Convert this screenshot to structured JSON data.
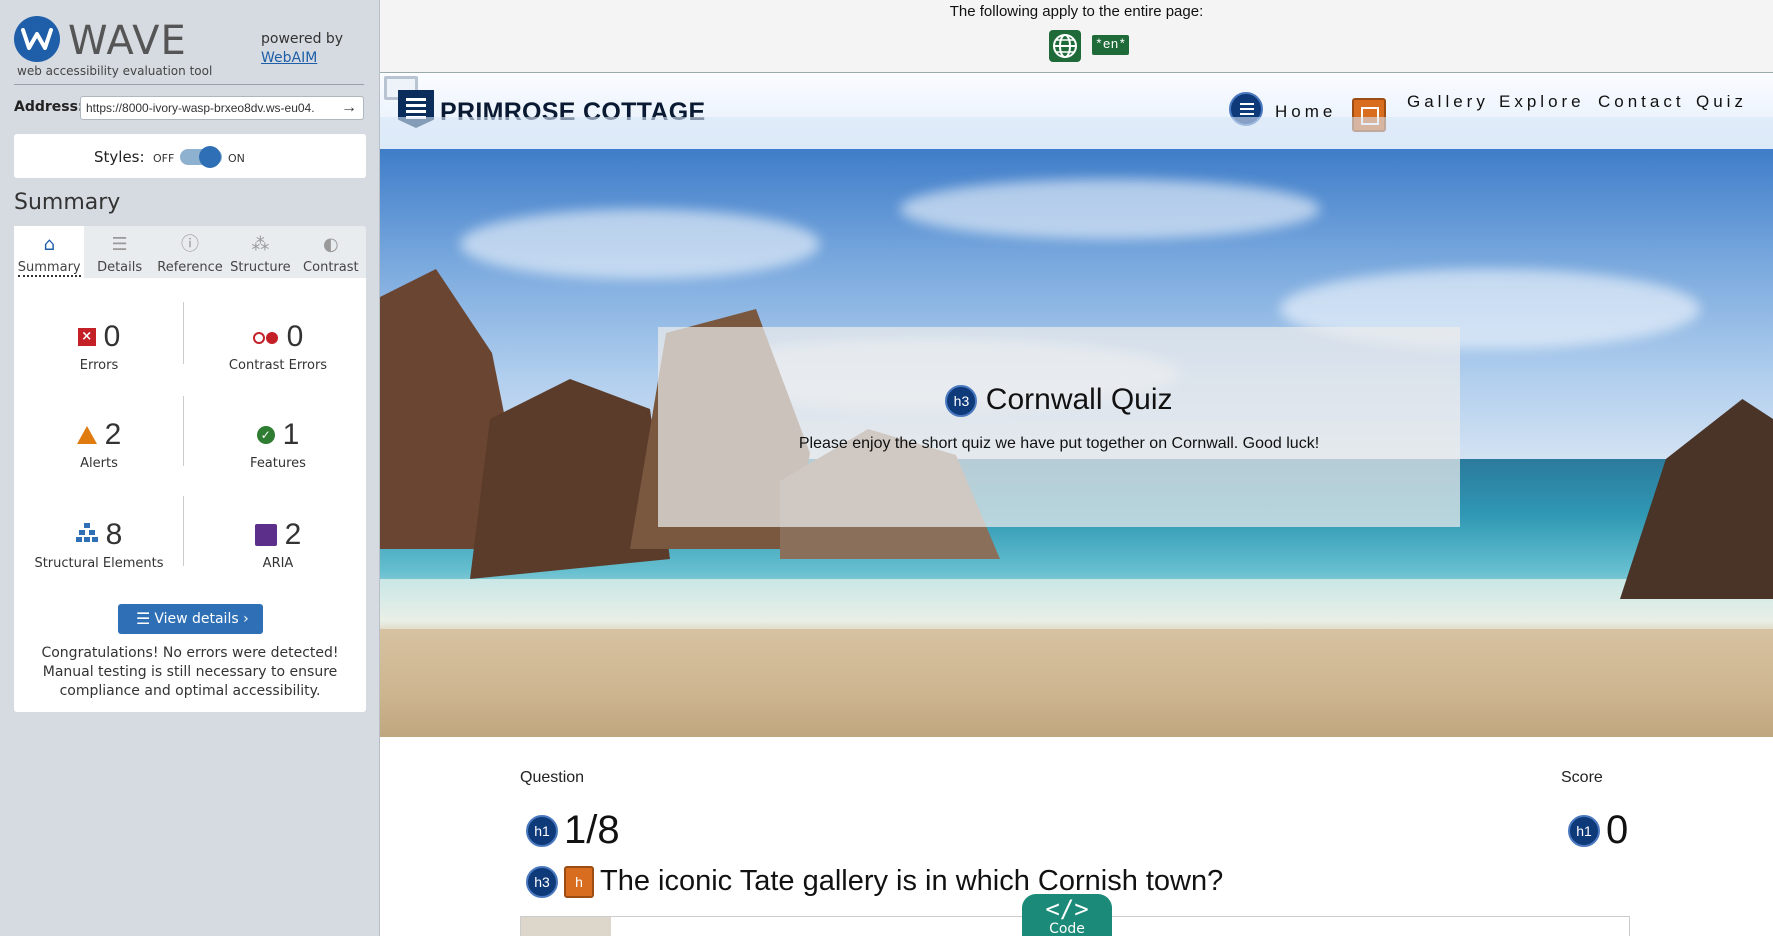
{
  "sidebar": {
    "logo_word": "WAVE",
    "logo_tagline": "web accessibility evaluation tool",
    "powered_by": "powered by",
    "webaim_link": "WebAIM",
    "address_label": "Address:",
    "address_value": "https://8000-ivory-wasp-brxeo8dv.ws-eu04.",
    "styles_label": "Styles:",
    "styles_off": "OFF",
    "styles_on": "ON",
    "summary_heading": "Summary",
    "tabs": [
      {
        "label": "Summary",
        "icon": "home-icon",
        "active": true
      },
      {
        "label": "Details",
        "icon": "list-icon",
        "active": false
      },
      {
        "label": "Reference",
        "icon": "info-icon",
        "active": false
      },
      {
        "label": "Structure",
        "icon": "hierarchy-icon",
        "active": false
      },
      {
        "label": "Contrast",
        "icon": "contrast-icon",
        "active": false
      }
    ],
    "stats": {
      "errors": {
        "count": "0",
        "label": "Errors"
      },
      "contrast_errors": {
        "count": "0",
        "label": "Contrast Errors"
      },
      "alerts": {
        "count": "2",
        "label": "Alerts"
      },
      "features": {
        "count": "1",
        "label": "Features"
      },
      "structural": {
        "count": "8",
        "label": "Structural Elements"
      },
      "aria": {
        "count": "2",
        "label": "ARIA"
      }
    },
    "view_details": "View details ›",
    "congrats": "Congratulations! No errors were detected! Manual testing is still necessary to ensure compliance and optimal accessibility."
  },
  "page": {
    "applies_text": "The following apply to the entire page:",
    "lang_badge": "*en*",
    "brand": "PRIMROSE COTTAGE",
    "nav": [
      "Home",
      "Gallery",
      "Explore",
      "Contact",
      "Quiz"
    ],
    "hero": {
      "badge": "h3",
      "title": "Cornwall Quiz",
      "subtitle": "Please enjoy the short quiz we have put together on Cornwall. Good luck!"
    },
    "question_label": "Question",
    "score_label": "Score",
    "question_badge": "h1",
    "question_count": "1/8",
    "score_badge": "h1",
    "score_value": "0",
    "question_text_badge": "h3",
    "question_text_alert": "h",
    "question_text": "The iconic Tate gallery is in which Cornish town?",
    "code_tab_glyph": "</>",
    "code_tab_label": "Code"
  },
  "colors": {
    "wave_blue": "#1f5fa9",
    "error_red": "#c42027",
    "alert_orange": "#e07b10",
    "feature_green": "#2e7d32",
    "aria_purple": "#5b2f8a",
    "code_teal": "#1c8a78",
    "lang_green": "#1e6b39"
  }
}
